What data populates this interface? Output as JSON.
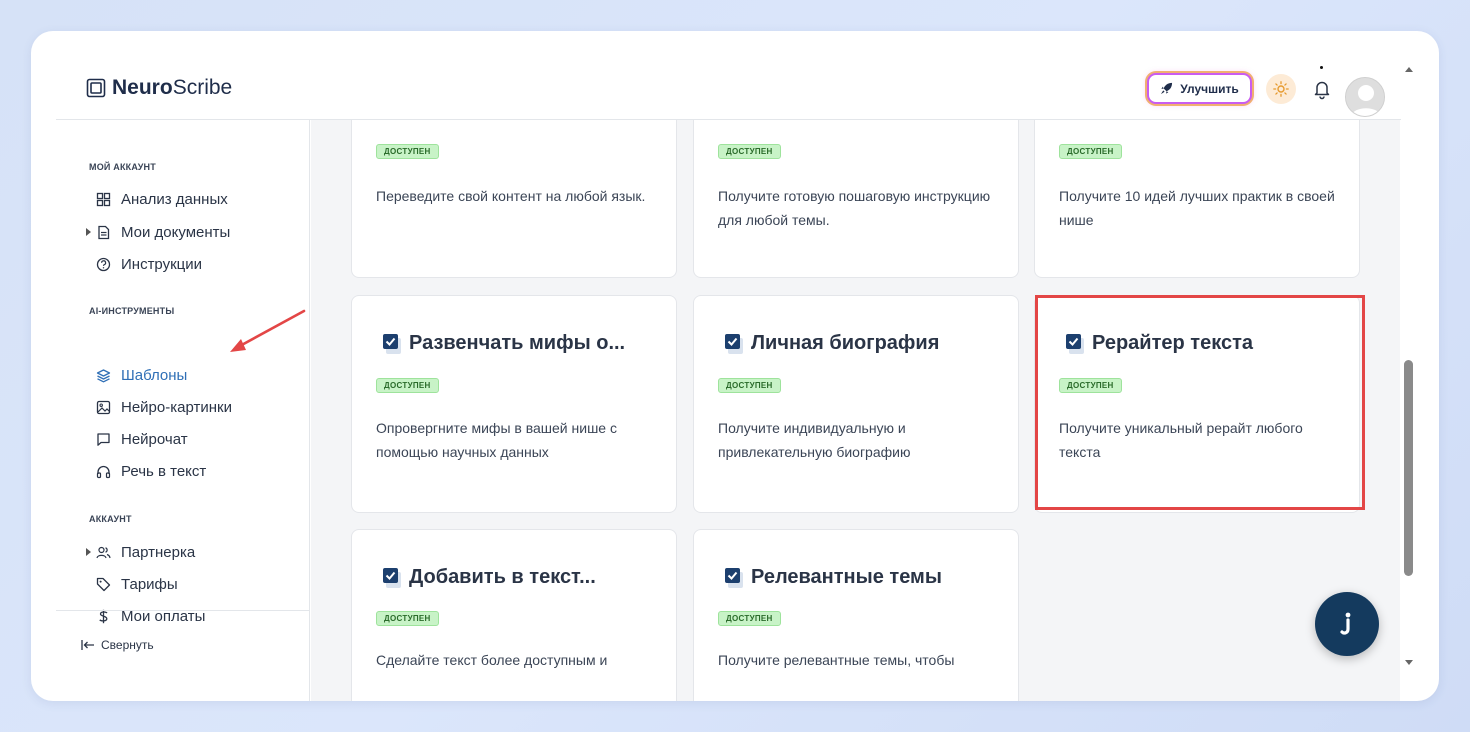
{
  "brand": {
    "bold": "Neuro",
    "regular": "Scribe"
  },
  "header": {
    "upgrade_label": "Улучшить"
  },
  "sidebar": {
    "sections": [
      {
        "title": "МОЙ АККАУНТ"
      },
      {
        "title": "AI-ИНСТРУМЕНТЫ"
      },
      {
        "title": "АККАУНТ"
      }
    ],
    "items": [
      {
        "label": "Анализ данных",
        "icon": "grid-icon"
      },
      {
        "label": "Мои документы",
        "icon": "document-icon"
      },
      {
        "label": "Инструкции",
        "icon": "help-circle-icon"
      },
      {
        "label": "Шаблоны",
        "icon": "layers-icon"
      },
      {
        "label": "Нейро-картинки",
        "icon": "image-icon"
      },
      {
        "label": "Нейрочат",
        "icon": "chat-icon"
      },
      {
        "label": "Речь в текст",
        "icon": "headphones-icon"
      },
      {
        "label": "Партнерка",
        "icon": "users-icon"
      },
      {
        "label": "Тарифы",
        "icon": "tag-icon"
      },
      {
        "label": "Мои оплаты",
        "icon": "dollar-icon"
      }
    ],
    "collapse_label": "Свернуть"
  },
  "cards": [
    {
      "title": "",
      "badge": "ДОСТУПЕН",
      "desc": "Переведите свой контент на любой язык."
    },
    {
      "title": "",
      "badge": "ДОСТУПЕН",
      "desc": "Получите готовую пошаговую инструкцию для любой темы."
    },
    {
      "title": "",
      "badge": "ДОСТУПЕН",
      "desc": "Получите 10 идей лучших практик в своей нише"
    },
    {
      "title": "Развенчать мифы о...",
      "badge": "ДОСТУПЕН",
      "desc": "Опровергните мифы в вашей нише с помощью научных данных"
    },
    {
      "title": "Личная биография",
      "badge": "ДОСТУПЕН",
      "desc": "Получите индивидуальную и привлекательную биографию"
    },
    {
      "title": "Рерайтер текста",
      "badge": "ДОСТУПЕН",
      "desc": "Получите уникальный рерайт любого текста"
    },
    {
      "title": "Добавить в текст...",
      "badge": "ДОСТУПЕН",
      "desc": "Сделайте текст более доступным и"
    },
    {
      "title": "Релевантные темы",
      "badge": "ДОСТУПЕН",
      "desc": "Получите релевантные темы, чтобы"
    }
  ],
  "colors": {
    "accent": "#2f6fb6",
    "badge_bg": "#c8f3c7",
    "highlight": "#e34646",
    "fab": "#143a5e"
  }
}
